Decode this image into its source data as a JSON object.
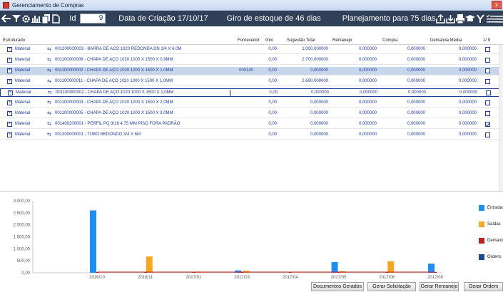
{
  "window": {
    "title": "Gerenciamento de Compras",
    "close_label": "x"
  },
  "toolbar": {
    "id_label": "Id",
    "id_value": "9",
    "created_label": "Data de Criação 17/10/17",
    "stock_turn_label": "Giro de estoque de  46 dias",
    "planning_label": "Planejamento para 75 dias",
    "icons_left": [
      "back-arrow-icon",
      "filter-icon",
      "gear-icon",
      "bar-chart-icon",
      "copy-icon",
      "new-document-icon"
    ],
    "icons_right": [
      "export-icon",
      "import-icon",
      "print-icon",
      "hat-icon",
      "tools-icon",
      "list-check-icon",
      "menu-icon"
    ]
  },
  "grid": {
    "columns": {
      "estruturado": "Estruturado",
      "fornecedor": "Fornecedor",
      "giro": "Giro",
      "sugestao": "Sugestão Total",
      "remanejo": "Remanejo",
      "compra": "Compra",
      "demanda": "Demanda Média",
      "pagina": "1/ 9"
    },
    "rows": [
      {
        "type": "Material",
        "desc": "001200000003 - BARRA DE ACO 1020 REDONDA  DN 1/4 X 6.0M",
        "fornecedor": "",
        "giro": "0,00",
        "sugestao": "1.000,000000",
        "remanejo": "0,000000",
        "compra": "0,000000",
        "demanda": "0,000000",
        "checked": false
      },
      {
        "type": "Material",
        "desc": "001100000008 - CHAPA DE AÇO 1020 1000 X 1500  X 0,9MM",
        "fornecedor": "",
        "giro": "0,00",
        "sugestao": "2.700,000000",
        "remanejo": "0,000000",
        "compra": "0,000000",
        "demanda": "0,000000",
        "checked": false
      },
      {
        "type": "Material",
        "desc": "001100000002 - CHAPA DE AÇO 1020 1000 X 1500  X 1,0MM",
        "fornecedor": "000140",
        "giro": "0,00",
        "sugestao": "0,000000",
        "remanejo": "0,000000",
        "compra": "0,000000",
        "demanda": "0,000000",
        "checked": false
      },
      {
        "type": "Material",
        "desc": "001100000011 - CHAPA DE AÇO 1020 1000 X 1500  X 1,0MM",
        "fornecedor": "",
        "giro": "0,00",
        "sugestao": "2.600,000000",
        "remanejo": "0,000000",
        "compra": "0,000000",
        "demanda": "0,000000",
        "checked": false
      },
      {
        "type": "Material",
        "desc": "001100000002 - CHAPA DE AÇO 1020 1000 X 1500  X 1,0MM",
        "fornecedor": "",
        "giro": "0,00",
        "sugestao": "0,000000",
        "remanejo": "0,000000",
        "compra": "0,000000",
        "demanda": "0,000000",
        "checked": false
      },
      {
        "type": "Material",
        "desc": "001100000003 - CHAPA DE AÇO 1020 1000 X 1500  X 2,0MM",
        "fornecedor": "",
        "giro": "0,00",
        "sugestao": "0,000000",
        "remanejo": "0,000000",
        "compra": "0,000000",
        "demanda": "0,000000",
        "checked": false
      },
      {
        "type": "Material",
        "desc": "001100000005 - CHAPA DE AÇO 1020 1000 X 1500  X 3.0MM",
        "fornecedor": "",
        "giro": "0,00",
        "sugestao": "0,000000",
        "remanejo": "0,000000",
        "compra": "0,000000",
        "demanda": "0,000000",
        "checked": false
      },
      {
        "type": "Material",
        "desc": "001400200001 - PERFIL PQ 3/16 4,75 MM PISO FORA PADRÃO",
        "fornecedor": "",
        "giro": "0,00",
        "sugestao": "0,000000",
        "remanejo": "0,000000",
        "compra": "0,000000",
        "demanda": "0,000000",
        "checked": true
      },
      {
        "type": "Material",
        "desc": "001300000001 - TUBO REDONDO 3/4 X 6M",
        "fornecedor": "",
        "giro": "0,00",
        "sugestao": "0,000000",
        "remanejo": "0,000000",
        "compra": "0,000000",
        "demanda": "0,000000",
        "checked": false
      }
    ]
  },
  "buttons": {
    "documentos": "Documentos Gerados",
    "solicitacao": "Gerar Solicitação",
    "remanejo": "Gerar Remanejo",
    "ordem": "Gerar Ordem"
  },
  "colors": {
    "toolbar_bg": "#2f4058",
    "entradas": "#1f8ef1",
    "saidas": "#f5a623",
    "demanda": "#c0201d",
    "ordens": "#1b4b8a"
  },
  "chart_data": {
    "type": "bar",
    "categories": [
      "2016/10",
      "2016/11",
      "2017/01",
      "2017/03",
      "2017/04",
      "2017/05",
      "2017/06",
      "2017/08"
    ],
    "series": [
      {
        "name": "Entradas",
        "values": [
          2600,
          0,
          0,
          100,
          0,
          450,
          0,
          380
        ]
      },
      {
        "name": "Saídas",
        "values": [
          0,
          680,
          50,
          80,
          0,
          60,
          480,
          0
        ]
      },
      {
        "name": "Demanda",
        "values": [
          30,
          30,
          30,
          30,
          30,
          30,
          30,
          30
        ]
      },
      {
        "name": "Ordens",
        "values": [
          0,
          0,
          0,
          0,
          0,
          0,
          0,
          0
        ]
      }
    ],
    "yticks": [
      "3.000,00",
      "2.500,00",
      "2.000,00",
      "1.500,00",
      "1.000,00",
      "500,00",
      "0,00"
    ],
    "ylim": [
      0,
      3000
    ],
    "grid": false,
    "legend_position": "right"
  }
}
